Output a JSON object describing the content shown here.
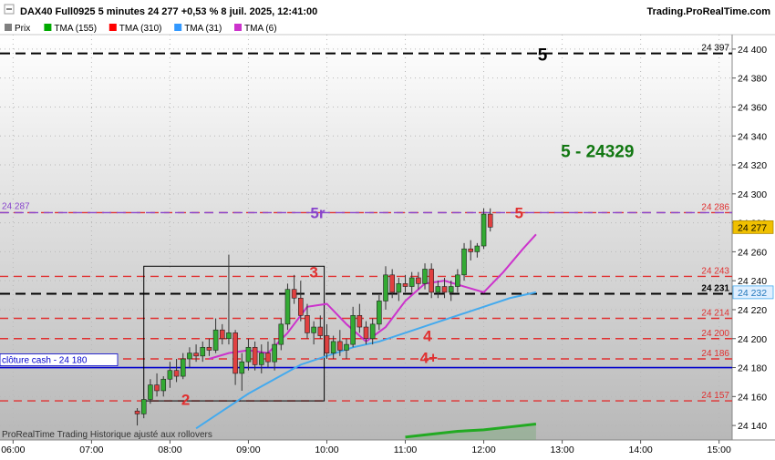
{
  "header": {
    "title": "DAX40 Full0925 5 minutes 24 277 +0,53 % 8 juil. 2025, 12:41:00",
    "brand": "Trading.ProRealTime.com"
  },
  "legend": [
    {
      "label": "Prix",
      "color": "#808080"
    },
    {
      "label": "TMA (155)",
      "color": "#00aa00"
    },
    {
      "label": "TMA (310)",
      "color": "#ff0000"
    },
    {
      "label": "TMA (31)",
      "color": "#3399ff"
    },
    {
      "label": "TMA (6)",
      "color": "#cc33cc"
    }
  ],
  "footer_note": "ProRealTime Trading  Historique ajusté aux rollovers",
  "colors": {
    "up": "#33aa33",
    "down": "#e04040",
    "tma6": "#cc33cc",
    "tma31": "#44aaee",
    "tma155": "#22aa22",
    "red_level": "#e03030",
    "black_level": "#000000",
    "purple_level": "#8844cc",
    "blue_level": "#0000cc",
    "price_badge": "#f0c000"
  },
  "chart_data": {
    "type": "candlestick",
    "ylim": [
      24130,
      24410
    ],
    "xlim": [
      "05:50",
      "15:10"
    ],
    "x_ticks": [
      "06:00",
      "07:00",
      "08:00",
      "09:00",
      "10:00",
      "11:00",
      "12:00",
      "13:00",
      "14:00",
      "15:00"
    ],
    "y_ticks": [
      24140,
      24160,
      24180,
      24200,
      24220,
      24240,
      24260,
      24280,
      24300,
      24320,
      24340,
      24360,
      24380,
      24400
    ],
    "y_tick_labels": [
      "24 140",
      "24 160",
      "24 180",
      "24 200",
      "24 220",
      "24 240",
      "24 260",
      "24 280",
      "24 300",
      "24 320",
      "24 340",
      "24 360",
      "24 380",
      "24 400"
    ],
    "levels": [
      {
        "value": 24397,
        "label": "24 397",
        "style": "black"
      },
      {
        "value": 24287,
        "label": "24 286",
        "style": "red"
      },
      {
        "value": 24287,
        "label": "24 287",
        "style": "purple",
        "left_label": "24 287"
      },
      {
        "value": 24243,
        "label": "24 243",
        "style": "red"
      },
      {
        "value": 24231,
        "label": "24 231",
        "style": "black"
      },
      {
        "value": 24214,
        "label": "24 214",
        "style": "red"
      },
      {
        "value": 24200,
        "label": "24 200",
        "style": "red"
      },
      {
        "value": 24186,
        "label": "24 186",
        "style": "red"
      },
      {
        "value": 24180,
        "label": "24 180",
        "style": "blue",
        "left_label": "clôture cash -  24 180"
      },
      {
        "value": 24157,
        "label": "24 157",
        "style": "red"
      }
    ],
    "axis_badges": [
      {
        "value": 24277,
        "label": "24 277",
        "style": "price"
      },
      {
        "value": 24232,
        "label": "24 232",
        "style": "tma31"
      }
    ],
    "annotations": [
      {
        "text": "5",
        "t": "12:45",
        "v": 24396,
        "color": "#000000"
      },
      {
        "text": "5 - 24329",
        "t": "13:27",
        "v": 24329,
        "color": "#117711"
      },
      {
        "text": "5r",
        "t": "09:53",
        "v": 24287,
        "color": "#8844cc"
      },
      {
        "text": "5",
        "t": "12:27",
        "v": 24287,
        "color": "#e03030"
      },
      {
        "text": "3",
        "t": "09:50",
        "v": 24246,
        "color": "#e03030"
      },
      {
        "text": "4",
        "t": "11:17",
        "v": 24202,
        "color": "#e03030"
      },
      {
        "text": "4+",
        "t": "11:18",
        "v": 24187,
        "color": "#e03030"
      },
      {
        "text": "2",
        "t": "08:12",
        "v": 24158,
        "color": "#e03030"
      }
    ],
    "box": {
      "t0": "07:40",
      "t1": "09:58",
      "v_top": 24250,
      "v_bottom": 24157
    },
    "ohlc_times": [
      "07:35",
      "07:40",
      "07:45",
      "07:50",
      "07:55",
      "08:00",
      "08:05",
      "08:10",
      "08:15",
      "08:20",
      "08:25",
      "08:30",
      "08:35",
      "08:40",
      "08:45",
      "08:50",
      "08:55",
      "09:00",
      "09:05",
      "09:10",
      "09:15",
      "09:20",
      "09:25",
      "09:30",
      "09:35",
      "09:40",
      "09:45",
      "09:50",
      "09:55",
      "10:00",
      "10:05",
      "10:10",
      "10:15",
      "10:20",
      "10:25",
      "10:30",
      "10:35",
      "10:40",
      "10:45",
      "10:50",
      "10:55",
      "11:00",
      "11:05",
      "11:10",
      "11:15",
      "11:20",
      "11:25",
      "11:30",
      "11:35",
      "11:40",
      "11:45",
      "11:50",
      "11:55",
      "12:00",
      "12:05",
      "12:10",
      "12:15",
      "12:20",
      "12:25",
      "12:30",
      "12:35",
      "12:40"
    ],
    "ohlc": [
      [
        24150,
        24152,
        24140,
        24148
      ],
      [
        24148,
        24160,
        24145,
        24158
      ],
      [
        24158,
        24172,
        24155,
        24168
      ],
      [
        24168,
        24176,
        24160,
        24164
      ],
      [
        24164,
        24174,
        24160,
        24172
      ],
      [
        24172,
        24184,
        24166,
        24178
      ],
      [
        24178,
        24186,
        24170,
        24174
      ],
      [
        24174,
        24190,
        24172,
        24186
      ],
      [
        24186,
        24194,
        24180,
        24190
      ],
      [
        24190,
        24196,
        24184,
        24188
      ],
      [
        24188,
        24198,
        24184,
        24194
      ],
      [
        24194,
        24200,
        24188,
        24192
      ],
      [
        24192,
        24214,
        24190,
        24206
      ],
      [
        24206,
        24210,
        24196,
        24200
      ],
      [
        24200,
        24258,
        24196,
        24204
      ],
      [
        24204,
        24206,
        24168,
        24176
      ],
      [
        24176,
        24190,
        24164,
        24184
      ],
      [
        24184,
        24200,
        24178,
        24194
      ],
      [
        24194,
        24198,
        24178,
        24182
      ],
      [
        24182,
        24196,
        24176,
        24190
      ],
      [
        24190,
        24198,
        24180,
        24184
      ],
      [
        24184,
        24200,
        24178,
        24196
      ],
      [
        24196,
        24214,
        24192,
        24210
      ],
      [
        24210,
        24238,
        24206,
        24234
      ],
      [
        24234,
        24244,
        24224,
        24228
      ],
      [
        24228,
        24240,
        24212,
        24216
      ],
      [
        24216,
        24224,
        24200,
        24204
      ],
      [
        24204,
        24212,
        24196,
        24208
      ],
      [
        24208,
        24216,
        24200,
        24202
      ],
      [
        24202,
        24210,
        24186,
        24190
      ],
      [
        24190,
        24202,
        24186,
        24198
      ],
      [
        24198,
        24206,
        24188,
        24192
      ],
      [
        24192,
        24200,
        24186,
        24196
      ],
      [
        24196,
        24222,
        24194,
        24216
      ],
      [
        24216,
        24224,
        24204,
        24208
      ],
      [
        24208,
        24212,
        24196,
        24200
      ],
      [
        24200,
        24214,
        24196,
        24210
      ],
      [
        24210,
        24230,
        24206,
        24226
      ],
      [
        24226,
        24250,
        24220,
        24244
      ],
      [
        24244,
        24248,
        24228,
        24232
      ],
      [
        24232,
        24242,
        24226,
        24238
      ],
      [
        24238,
        24244,
        24232,
        24236
      ],
      [
        24236,
        24246,
        24232,
        24242
      ],
      [
        24242,
        24246,
        24234,
        24238
      ],
      [
        24238,
        24252,
        24234,
        24248
      ],
      [
        24248,
        24252,
        24228,
        24232
      ],
      [
        24232,
        24240,
        24228,
        24236
      ],
      [
        24236,
        24242,
        24228,
        24232
      ],
      [
        24232,
        24240,
        24226,
        24236
      ],
      [
        24236,
        24248,
        24232,
        24244
      ],
      [
        24244,
        24266,
        24240,
        24262
      ],
      [
        24262,
        24268,
        24254,
        24260
      ],
      [
        24260,
        24266,
        24256,
        24264
      ],
      [
        24264,
        24290,
        24262,
        24286
      ],
      [
        24286,
        24290,
        24274,
        24277
      ]
    ],
    "series": [
      {
        "name": "TMA (6)",
        "x": [
          "08:30",
          "08:45",
          "09:00",
          "09:15",
          "09:30",
          "09:45",
          "10:00",
          "10:15",
          "10:30",
          "10:45",
          "11:00",
          "11:15",
          "11:30",
          "11:45",
          "12:00",
          "12:15",
          "12:30",
          "12:40"
        ],
        "values": [
          24186,
          24190,
          24192,
          24190,
          24204,
          24222,
          24224,
          24210,
          24198,
          24208,
          24226,
          24238,
          24240,
          24236,
          24232,
          24246,
          24262,
          24272
        ]
      },
      {
        "name": "TMA (31)",
        "x": [
          "08:20",
          "08:40",
          "09:00",
          "09:20",
          "09:40",
          "10:00",
          "10:20",
          "10:40",
          "11:00",
          "11:20",
          "11:40",
          "12:00",
          "12:20",
          "12:40"
        ],
        "values": [
          24138,
          24150,
          24162,
          24172,
          24182,
          24188,
          24194,
          24198,
          24204,
          24210,
          24216,
          24222,
          24228,
          24232
        ]
      },
      {
        "name": "TMA (155)",
        "x": [
          "11:00",
          "11:20",
          "11:40",
          "12:00",
          "12:20",
          "12:40"
        ],
        "values": [
          24132,
          24134,
          24136,
          24137,
          24139,
          24141
        ]
      }
    ]
  }
}
